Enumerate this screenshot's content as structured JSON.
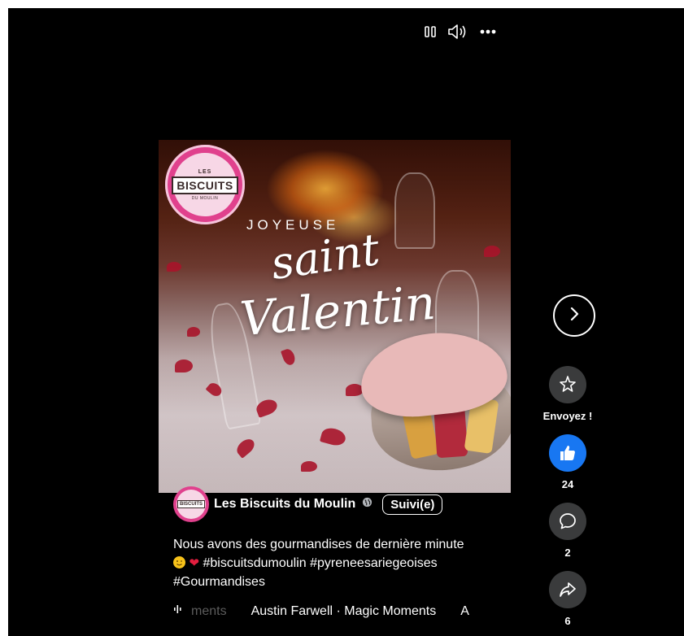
{
  "top_controls": {
    "pause_icon": "pause-icon",
    "volume_icon": "volume-icon",
    "more_icon": "more-icon"
  },
  "media": {
    "logo": {
      "les": "LES",
      "name": "BISCUITS",
      "sub": "DU MOULIN"
    },
    "headline": "JOYEUSE",
    "script_line_1": "saint",
    "script_line_2": "Valentin"
  },
  "actions": {
    "send": {
      "label": "Envoyez !",
      "icon": "sparkle-star-icon"
    },
    "like": {
      "count": "24",
      "icon": "thumbs-up-icon",
      "color": "#1877f2"
    },
    "comment": {
      "count": "2",
      "icon": "comment-icon"
    },
    "share": {
      "count": "6",
      "icon": "share-icon"
    }
  },
  "author": {
    "avatar_text": "BISCUITS",
    "name": "Les Biscuits du Moulin",
    "follow_label": "Suivi(e)"
  },
  "caption": {
    "line1": "Nous avons des gourmandises  de dernière minute",
    "hashtags": "#biscuitsdumoulin #pyreneesariegeoises",
    "line3": "#Gourmandises"
  },
  "music": {
    "faded": "ments",
    "track": "Austin Farwell · Magic Moments",
    "tail": "A"
  }
}
